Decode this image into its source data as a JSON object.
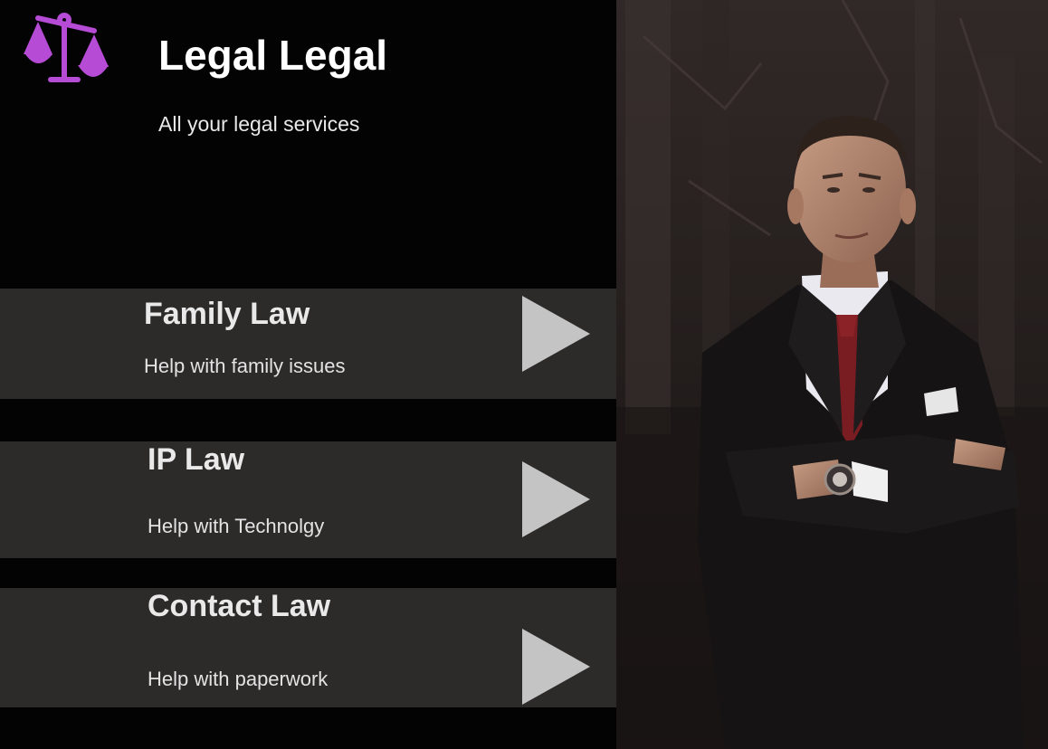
{
  "brand": {
    "title": "Legal Legal",
    "subtitle": "All your legal services",
    "logo_icon": "scales-of-justice-icon",
    "accent_color": "#b64bd6"
  },
  "services": [
    {
      "title": "Family Law",
      "description": "Help with family issues",
      "icon": "play-arrow-icon"
    },
    {
      "title": "IP Law",
      "description": "Help with Technolgy",
      "icon": "play-arrow-icon"
    },
    {
      "title": "Contact Law",
      "description": "Help with paperwork",
      "icon": "play-arrow-icon"
    }
  ],
  "colors": {
    "background": "#030303",
    "card": "#2d2a2a",
    "arrow": "#c4c4c4"
  },
  "hero_image": {
    "subject": "man in dark suit with red tie, arms crossed"
  }
}
